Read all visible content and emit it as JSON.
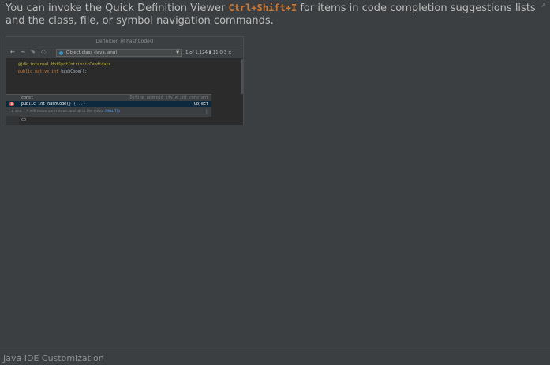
{
  "tip": {
    "text_before": "You can invoke the Quick Definition Viewer ",
    "shortcut": "Ctrl+Shift+I",
    "text_after": " for items in code completion suggestions lists and the class, file, or symbol navigation commands."
  },
  "preview": {
    "window_title": "Definition of hashCode()",
    "toolbar": {
      "back_icon": "back-arrow-icon",
      "forward_icon": "forward-arrow-icon",
      "edit_icon": "edit-icon",
      "pin_icon": "pin-icon",
      "selected_source": "Object.class (java.lang)",
      "counter": "1 of 1,124",
      "version": "11.0.3"
    },
    "code_lines": {
      "annotation": "@jdk.internal.HotSpotIntrinsicCandidate",
      "kw_public": "public",
      "kw_native": "native",
      "kw_int": "int",
      "method": "hashCode();"
    },
    "completion": {
      "row1_left": "const",
      "row1_right": "Define android style int constant",
      "row2_badge": "m",
      "row2_left": "public int hashCode()",
      "row2_params": "{...}",
      "row2_right": "Object",
      "hint_text": "^↓ and ^↑ will move caret down and up in the editor",
      "hint_link": "Next Tip",
      "more_icon": "⋮"
    },
    "editor_text": "co"
  },
  "status_bar": {
    "label": "Java IDE Customization"
  },
  "colors": {
    "background": "#3c3f41",
    "shortcut": "#cc7832",
    "editor_bg": "#2b2b2b",
    "selection": "#0d293e",
    "link": "#589df6"
  }
}
